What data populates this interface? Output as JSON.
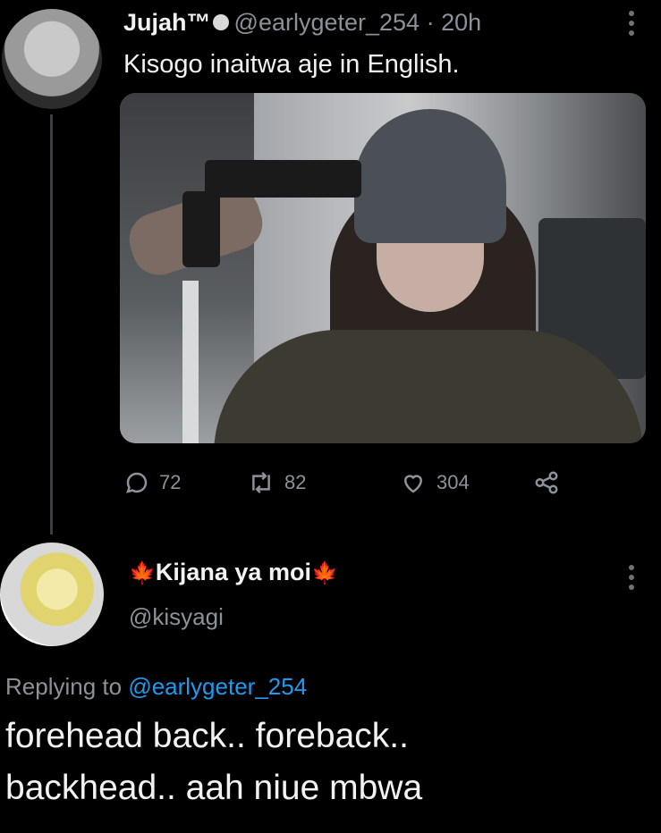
{
  "tweet1": {
    "name": "Jujah™",
    "handle": "@earlygeter_254",
    "separator": "·",
    "time": "20h",
    "text": "Kisogo inaitwa aje in English.",
    "actions": {
      "replies": "72",
      "retweets": "82",
      "likes": "304"
    }
  },
  "tweet2": {
    "name": "Kijana ya moi",
    "leaf": "🍁",
    "handle": "@kisyagi",
    "replying_prefix": "Replying to",
    "replying_handle": "@earlygeter_254",
    "text_line1": "forehead back.. foreback..",
    "text_line2": "backhead.. aah niue mbwa"
  },
  "colors": {
    "background": "#000000",
    "muted": "#8b9299",
    "link": "#1d9bf0",
    "leaf": "#d4822e"
  },
  "icons": [
    "reply-icon",
    "retweet-icon",
    "like-icon",
    "share-icon",
    "more-icon",
    "verified-icon",
    "maple-leaf-icon"
  ]
}
